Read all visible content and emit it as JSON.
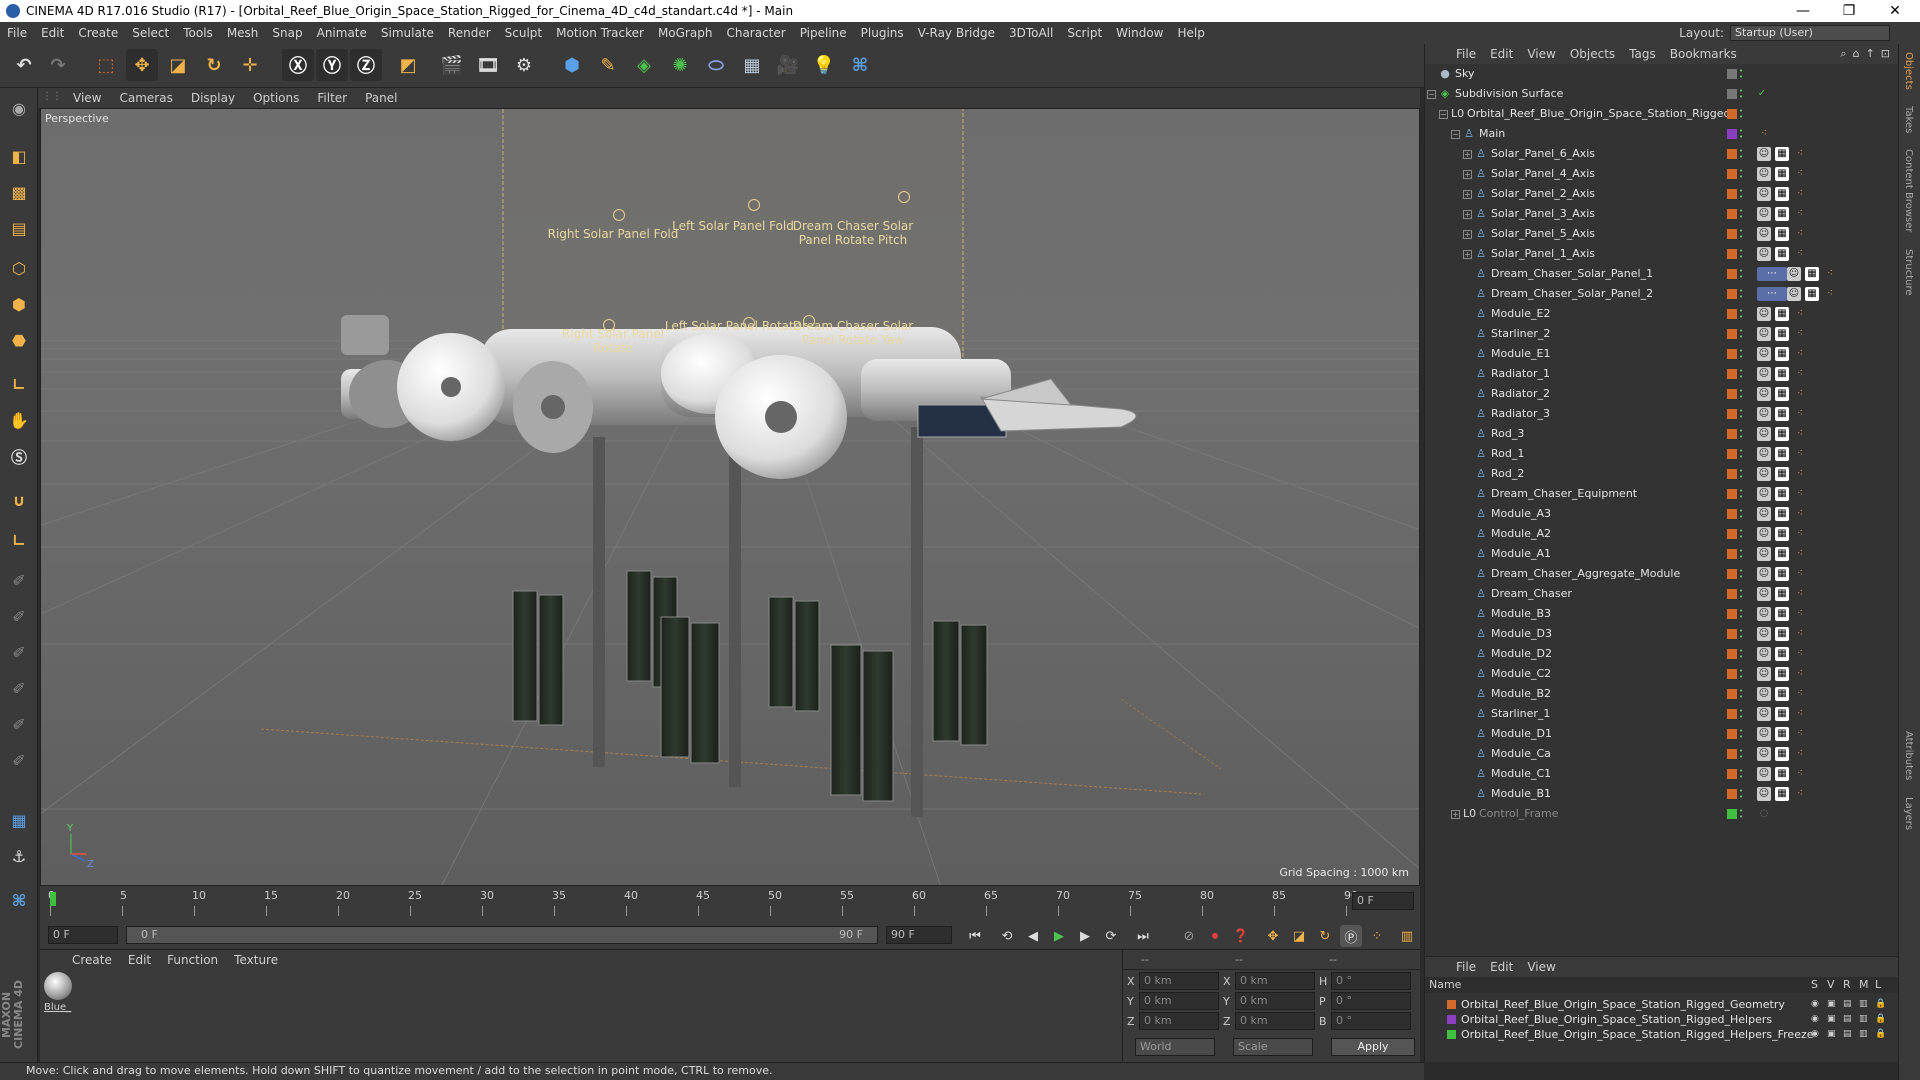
{
  "window": {
    "title": "CINEMA 4D R17.016 Studio (R17) - [Orbital_Reef_Blue_Origin_Space_Station_Rigged_for_Cinema_4D_c4d_standart.c4d *] - Main",
    "controls": [
      "—",
      "❐",
      "✕"
    ]
  },
  "menu": [
    "File",
    "Edit",
    "Create",
    "Select",
    "Tools",
    "Mesh",
    "Snap",
    "Animate",
    "Simulate",
    "Render",
    "Sculpt",
    "Motion Tracker",
    "MoGraph",
    "Character",
    "Pipeline",
    "Plugins",
    "V-Ray Bridge",
    "3DToAll",
    "Script",
    "Window",
    "Help"
  ],
  "layout": {
    "label": "Layout:",
    "value": "Startup (User)"
  },
  "viewport": {
    "menu": [
      "View",
      "Cameras",
      "Display",
      "Options",
      "Filter",
      "Panel"
    ],
    "label": "Perspective",
    "grid_spacing": "Grid Spacing : 1000 km",
    "controls": [
      "Right Solar Panel Fold",
      "Left Solar Panel Fold",
      "Dream Chaser Solar Panel Rotate Pitch",
      "Right Solar Panel Rotate",
      "Left Solar Panel Rotate",
      "Dream Chaser Solar Panel Rotate Yaw"
    ],
    "axis": {
      "y": "Y",
      "z": "Z"
    }
  },
  "timeline": {
    "ticks": [
      "0",
      "5",
      "10",
      "15",
      "20",
      "25",
      "30",
      "35",
      "40",
      "45",
      "50",
      "55",
      "60",
      "65",
      "70",
      "75",
      "80",
      "85",
      "90"
    ],
    "end_field": "0 F"
  },
  "transport": {
    "start": "0 F",
    "range_start": "0 F",
    "range_end": "90 F",
    "max": "90 F"
  },
  "materials": {
    "menu": [
      "Create",
      "Edit",
      "Function",
      "Texture"
    ],
    "items": [
      {
        "name": "Blue_"
      }
    ]
  },
  "coords": {
    "head": [
      "--",
      "--",
      "--"
    ],
    "rows": [
      {
        "a": "X",
        "av": "0 km",
        "b": "X",
        "bv": "0 km",
        "c": "H",
        "cv": "0 °"
      },
      {
        "a": "Y",
        "av": "0 km",
        "b": "Y",
        "bv": "0 km",
        "c": "P",
        "cv": "0 °"
      },
      {
        "a": "Z",
        "av": "0 km",
        "b": "Z",
        "bv": "0 km",
        "c": "B",
        "cv": "0 °"
      }
    ],
    "world": "World",
    "scale": "Scale",
    "apply": "Apply"
  },
  "status": "Move: Click and drag to move elements. Hold down SHIFT to quantize movement / add to the selection in point mode, CTRL to remove.",
  "objects": {
    "menu": [
      "File",
      "Edit",
      "View",
      "Objects",
      "Tags",
      "Bookmarks"
    ],
    "rows": [
      {
        "name": "Sky",
        "depth": 0,
        "exp": "",
        "icon": "sky"
      },
      {
        "name": "Subdivision Surface",
        "depth": 0,
        "exp": "−",
        "icon": "subd"
      },
      {
        "name": "Orbital_Reef_Blue_Origin_Space_Station_Rigged",
        "depth": 1,
        "exp": "−",
        "icon": "null"
      },
      {
        "name": "Main",
        "depth": 2,
        "exp": "−",
        "icon": "joint"
      },
      {
        "name": "Solar_Panel_6_Axis",
        "depth": 3,
        "exp": "+",
        "icon": "joint"
      },
      {
        "name": "Solar_Panel_4_Axis",
        "depth": 3,
        "exp": "+",
        "icon": "joint"
      },
      {
        "name": "Solar_Panel_2_Axis",
        "depth": 3,
        "exp": "+",
        "icon": "joint"
      },
      {
        "name": "Solar_Panel_3_Axis",
        "depth": 3,
        "exp": "+",
        "icon": "joint"
      },
      {
        "name": "Solar_Panel_5_Axis",
        "depth": 3,
        "exp": "+",
        "icon": "joint"
      },
      {
        "name": "Solar_Panel_1_Axis",
        "depth": 3,
        "exp": "+",
        "icon": "joint"
      },
      {
        "name": "Dream_Chaser_Solar_Panel_1",
        "depth": 3,
        "exp": "",
        "icon": "joint"
      },
      {
        "name": "Dream_Chaser_Solar_Panel_2",
        "depth": 3,
        "exp": "",
        "icon": "joint"
      },
      {
        "name": "Module_E2",
        "depth": 3,
        "exp": "",
        "icon": "joint"
      },
      {
        "name": "Starliner_2",
        "depth": 3,
        "exp": "",
        "icon": "joint"
      },
      {
        "name": "Module_E1",
        "depth": 3,
        "exp": "",
        "icon": "joint"
      },
      {
        "name": "Radiator_1",
        "depth": 3,
        "exp": "",
        "icon": "joint"
      },
      {
        "name": "Radiator_2",
        "depth": 3,
        "exp": "",
        "icon": "joint"
      },
      {
        "name": "Radiator_3",
        "depth": 3,
        "exp": "",
        "icon": "joint"
      },
      {
        "name": "Rod_3",
        "depth": 3,
        "exp": "",
        "icon": "joint"
      },
      {
        "name": "Rod_1",
        "depth": 3,
        "exp": "",
        "icon": "joint"
      },
      {
        "name": "Rod_2",
        "depth": 3,
        "exp": "",
        "icon": "joint"
      },
      {
        "name": "Dream_Chaser_Equipment",
        "depth": 3,
        "exp": "",
        "icon": "joint"
      },
      {
        "name": "Module_A3",
        "depth": 3,
        "exp": "",
        "icon": "joint"
      },
      {
        "name": "Module_A2",
        "depth": 3,
        "exp": "",
        "icon": "joint"
      },
      {
        "name": "Module_A1",
        "depth": 3,
        "exp": "",
        "icon": "joint"
      },
      {
        "name": "Dream_Chaser_Aggregate_Module",
        "depth": 3,
        "exp": "",
        "icon": "joint"
      },
      {
        "name": "Dream_Chaser",
        "depth": 3,
        "exp": "",
        "icon": "joint"
      },
      {
        "name": "Module_B3",
        "depth": 3,
        "exp": "",
        "icon": "joint"
      },
      {
        "name": "Module_D3",
        "depth": 3,
        "exp": "",
        "icon": "joint"
      },
      {
        "name": "Module_D2",
        "depth": 3,
        "exp": "",
        "icon": "joint"
      },
      {
        "name": "Module_C2",
        "depth": 3,
        "exp": "",
        "icon": "joint"
      },
      {
        "name": "Module_B2",
        "depth": 3,
        "exp": "",
        "icon": "joint"
      },
      {
        "name": "Starliner_1",
        "depth": 3,
        "exp": "",
        "icon": "joint"
      },
      {
        "name": "Module_D1",
        "depth": 3,
        "exp": "",
        "icon": "joint"
      },
      {
        "name": "Module_Ca",
        "depth": 3,
        "exp": "",
        "icon": "joint"
      },
      {
        "name": "Module_C1",
        "depth": 3,
        "exp": "",
        "icon": "joint"
      },
      {
        "name": "Module_B1",
        "depth": 3,
        "exp": "",
        "icon": "joint"
      },
      {
        "name": "Control_Frame",
        "depth": 2,
        "exp": "+",
        "icon": "null"
      }
    ]
  },
  "layers": {
    "menu": [
      "File",
      "Edit",
      "View"
    ],
    "head": {
      "name": "Name",
      "cols": [
        "S",
        "V",
        "R",
        "M",
        "L"
      ]
    },
    "rows": [
      {
        "name": "Orbital_Reef_Blue_Origin_Space_Station_Rigged_Geometry",
        "color": "#d46a2a"
      },
      {
        "name": "Orbital_Reef_Blue_Origin_Space_Station_Rigged_Helpers",
        "color": "#8a3fc0"
      },
      {
        "name": "Orbital_Reef_Blue_Origin_Space_Station_Rigged_Helpers_Freeze",
        "color": "#3fbf3f"
      }
    ]
  },
  "right_tabs": [
    "Objects",
    "Takes",
    "Content Browser",
    "Structure",
    "Attributes",
    "Layers"
  ],
  "colors": {
    "accent": "#e0a050",
    "layer_orange": "#d46a2a",
    "layer_purple": "#8a3fc0",
    "layer_green": "#3fbf3f"
  }
}
